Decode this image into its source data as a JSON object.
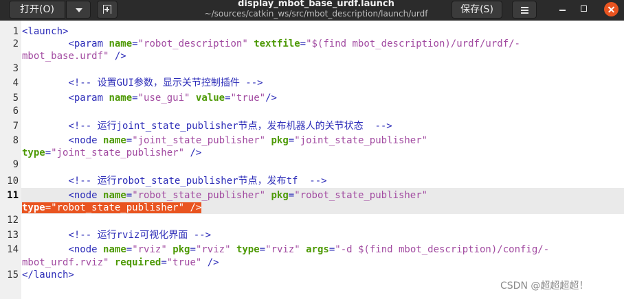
{
  "header": {
    "open_label": "打开(O)",
    "save_label": "保存(S)",
    "title": "display_mbot_base_urdf.launch",
    "subtitle": "~/sources/catkin_ws/src/mbot_description/launch/urdf",
    "icons": [
      "chevron-down-icon",
      "new-tab-icon",
      "menu-icon",
      "minimize-icon",
      "maximize-icon",
      "close-icon"
    ]
  },
  "editor": {
    "current_line": 11,
    "line_numbers": [
      "1",
      "2",
      "3",
      "4",
      "5",
      "6",
      "7",
      "8",
      "9",
      "10",
      "11",
      "12",
      "13",
      "14",
      "15"
    ],
    "code": {
      "l1": {
        "t1": "<launch>"
      },
      "l2": {
        "t1": "<param",
        "a1": "name",
        "s1": "\"robot_description\"",
        "a2": "textfile",
        "s2a": "\"$(find mbot_description)/urdf/urdf/-",
        "s2b": "mbot_base.urdf\"",
        "t2": " />"
      },
      "l4": {
        "c1": "<!-- 设置GUI参数，显示关节控制插件 -->"
      },
      "l5": {
        "t1": "<param",
        "a1": "name",
        "s1": "\"use_gui\"",
        "a2": "value",
        "s2": "\"true\"",
        "t2": "/>"
      },
      "l7": {
        "c1": "<!-- 运行joint_state_publisher节点，发布机器人的关节状态  -->"
      },
      "l8": {
        "t1": "<node",
        "a1": "name",
        "s1": "\"joint_state_publisher\"",
        "a2": "pkg",
        "s2": "\"joint_state_publisher\"",
        "a3": "type",
        "s3": "\"joint_state_publisher\"",
        "t2": " />"
      },
      "l10": {
        "c1": "<!-- 运行robot_state_publisher节点，发布tf  -->"
      },
      "l11": {
        "t1": "<node",
        "a1": "name",
        "s1": "\"robot_state_publisher\"",
        "a2": "pkg",
        "s2": "\"robot_state_publisher\"",
        "a3": "type",
        "s3": "\"robot_state_publisher\"",
        "t2": " />"
      },
      "l13": {
        "c1": "<!-- 运行rviz可视化界面 -->"
      },
      "l14": {
        "t1": "<node",
        "a1": "name",
        "s1": "\"rviz\"",
        "a2": "pkg",
        "s2": "\"rviz\"",
        "a3": "type",
        "s3": "\"rviz\"",
        "a4": "args",
        "s4a": "\"-d $(find mbot_description)/config/-",
        "s4b": "mbot_urdf.rviz\"",
        "a5": "required",
        "s5": "\"true\"",
        "t2": " />"
      },
      "l15": {
        "t1": "</launch>"
      }
    }
  },
  "watermark": "CSDN @超超超超！",
  "colors": {
    "accent": "#e95420",
    "tag": "#2c2cb8",
    "attribute": "#4e9a06",
    "string": "#a24ba1",
    "headerbar": "#2b2b2b"
  }
}
